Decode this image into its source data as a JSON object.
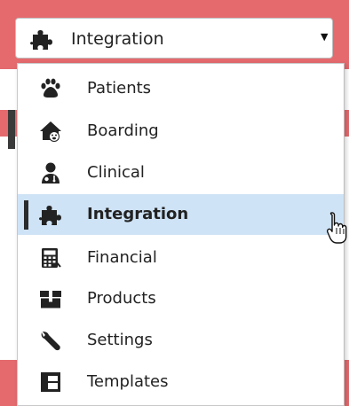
{
  "select": {
    "value": "Integration",
    "icon": "puzzle-icon",
    "caret_icon": "caret-down-icon"
  },
  "menu": {
    "items": [
      {
        "label": "Patients",
        "icon": "paw-icon",
        "active": false
      },
      {
        "label": "Boarding",
        "icon": "house-paw-icon",
        "active": false
      },
      {
        "label": "Clinical",
        "icon": "doctor-icon",
        "active": false
      },
      {
        "label": "Integration",
        "icon": "puzzle-icon",
        "active": true
      },
      {
        "label": "Financial",
        "icon": "calculator-icon",
        "active": false
      },
      {
        "label": "Products",
        "icon": "box-icon",
        "active": false
      },
      {
        "label": "Settings",
        "icon": "wrench-icon",
        "active": false
      },
      {
        "label": "Templates",
        "icon": "layout-icon",
        "active": false
      }
    ]
  },
  "colors": {
    "accent_red": "#e46a6e",
    "active_bg": "#cfe3f6",
    "icon_dark": "#222222"
  }
}
